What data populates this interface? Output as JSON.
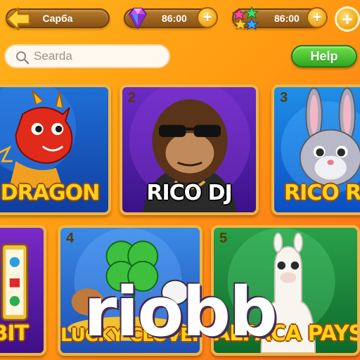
{
  "topbar": {
    "back_label": "Capбa",
    "gems_value": "86:00",
    "stars_value": "86:00",
    "plus_glyph": "+"
  },
  "search": {
    "placeholder": "Searda"
  },
  "help_label": "Help",
  "games": [
    {
      "num": "",
      "title": "O DRAGON",
      "style": "yellow"
    },
    {
      "num": "2",
      "title": "RICO DJ",
      "style": "white"
    },
    {
      "num": "3",
      "title": "RICO RAB",
      "style": "yellow"
    },
    {
      "num": "",
      "title": "BIT",
      "style": "yellow"
    },
    {
      "num": "4",
      "title": "LUCKY CLOVER WILD",
      "style": "yellow"
    },
    {
      "num": "5",
      "title": "ALPACA PAYS",
      "style": "yellow"
    }
  ],
  "watermark": "riobb",
  "colors": {
    "background": "#ff9a12",
    "help_green": "#2fa61f",
    "card_border": "#f0b545",
    "title_yellow": "#ffd21a"
  },
  "icons": [
    "back-arrow-icon",
    "gem-icon",
    "stars-icon",
    "plus-icon",
    "search-icon"
  ]
}
